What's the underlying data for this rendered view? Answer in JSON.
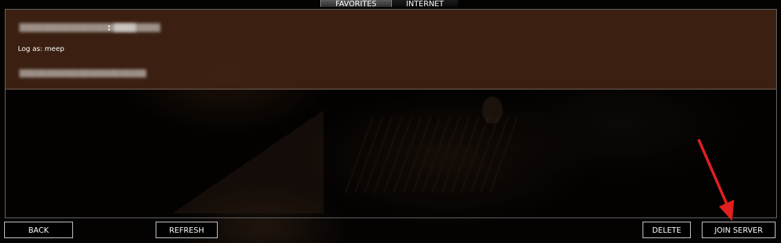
{
  "tabs": [
    {
      "label": "FAVORITES",
      "active": true
    },
    {
      "label": "INTERNET",
      "active": false
    }
  ],
  "server": {
    "name_obscured": "",
    "colon": ":",
    "port_obscured": "",
    "login_label": "Log as: meep",
    "description_obscured": ""
  },
  "buttons": {
    "back": "BACK",
    "refresh": "REFRESH",
    "delete": "DELETE",
    "join": "JOIN SERVER"
  },
  "colors": {
    "selected_row": "#40220f",
    "annotation_arrow": "#e01f1f"
  }
}
